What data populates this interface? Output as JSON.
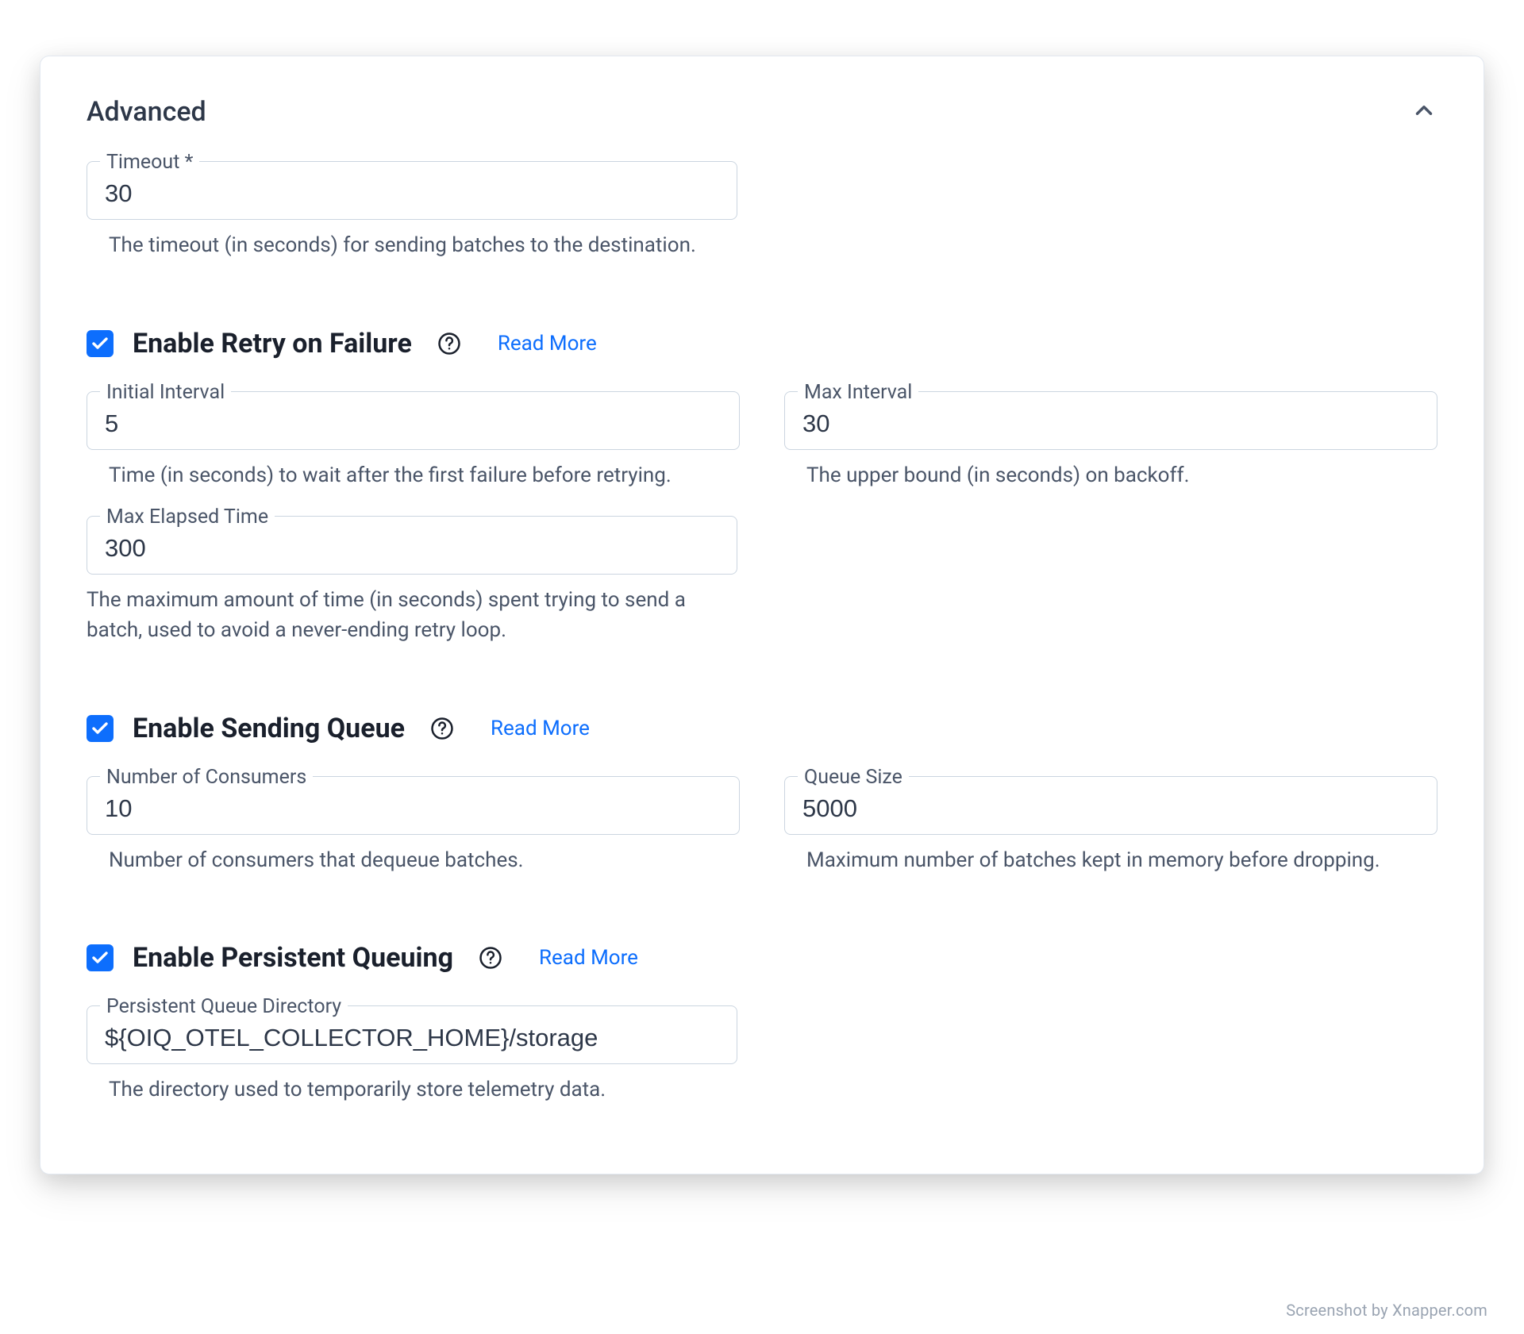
{
  "section": {
    "title": "Advanced"
  },
  "links": {
    "read_more": "Read More"
  },
  "timeout": {
    "label": "Timeout *",
    "value": "30",
    "helper": "The timeout (in seconds) for sending batches to the destination."
  },
  "retry": {
    "checked": true,
    "label": "Enable Retry on Failure",
    "initial_interval": {
      "label": "Initial Interval",
      "value": "5",
      "helper": "Time (in seconds) to wait after the first failure before retrying."
    },
    "max_interval": {
      "label": "Max Interval",
      "value": "30",
      "helper": "The upper bound (in seconds) on backoff."
    },
    "max_elapsed": {
      "label": "Max Elapsed Time",
      "value": "300",
      "helper": "The maximum amount of time (in seconds) spent trying to send a batch, used to avoid a never-ending retry loop."
    }
  },
  "queue": {
    "checked": true,
    "label": "Enable Sending Queue",
    "consumers": {
      "label": "Number of Consumers",
      "value": "10",
      "helper": "Number of consumers that dequeue batches."
    },
    "size": {
      "label": "Queue Size",
      "value": "5000",
      "helper": "Maximum number of batches kept in memory before dropping."
    }
  },
  "persist": {
    "checked": true,
    "label": "Enable Persistent Queuing",
    "dir": {
      "label": "Persistent Queue Directory",
      "value": "${OIQ_OTEL_COLLECTOR_HOME}/storage",
      "helper": "The directory used to temporarily store telemetry data."
    }
  },
  "attribution": "Screenshot by Xnapper.com"
}
